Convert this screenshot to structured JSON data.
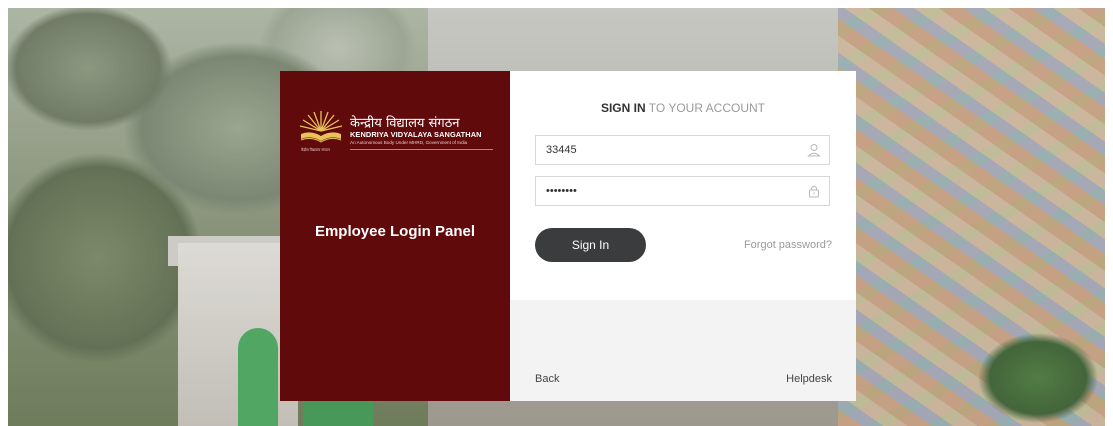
{
  "panel": {
    "logo_hindi": "केन्द्रीय विद्यालय संगठन",
    "logo_english": "KENDRIYA VIDYALAYA SANGATHAN",
    "logo_sub": "An Autonomous Body Under MHRD, Government of India",
    "logo_caption": "केंद्रीय विद्यालय संगठन",
    "title": "Employee Login Panel"
  },
  "login": {
    "heading_bold": "SIGN IN",
    "heading_light": "TO YOUR ACCOUNT",
    "username_value": "33445",
    "username_icon": "user-icon",
    "password_value": "password",
    "password_icon": "lock-icon",
    "signin_label": "Sign In",
    "forgot_label": "Forgot password?"
  },
  "footer": {
    "back_label": "Back",
    "helpdesk_label": "Helpdesk"
  },
  "colors": {
    "panel_bg": "#600a0c",
    "button_bg": "#3a3c3e"
  }
}
